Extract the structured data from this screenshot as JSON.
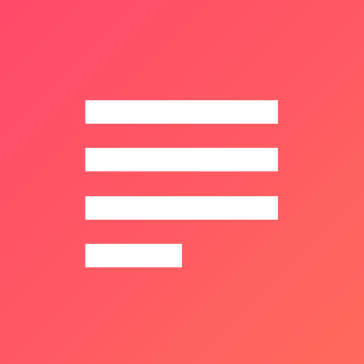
{
  "app_icon": {
    "icon_name": "text-lines-icon",
    "background_colors": [
      "#ff4a6a",
      "#ff5a62",
      "#ff6a5c"
    ],
    "foreground_color": "#ffffff"
  }
}
